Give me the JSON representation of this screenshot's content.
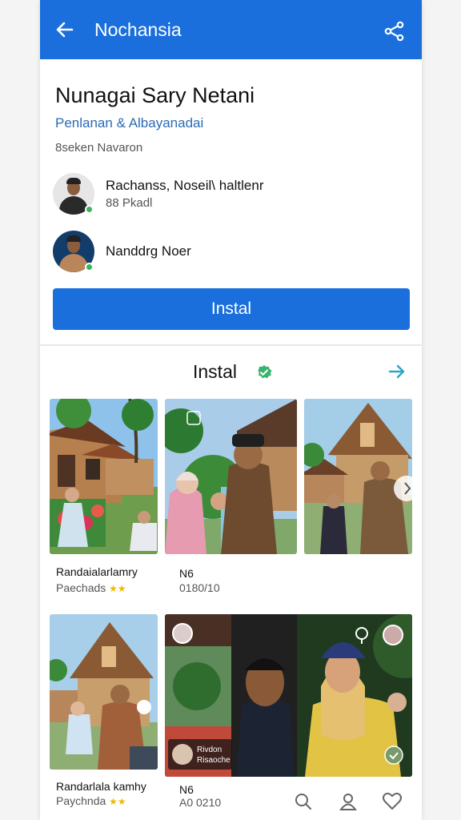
{
  "appbar": {
    "title": "Nochansia",
    "back_icon": "back-arrow-icon",
    "share_icon": "share-icon",
    "color": "#1a6fdc"
  },
  "app": {
    "title": "Nunagai Sary Netani",
    "subtitle": "Penlanan & Albayanadai",
    "meta": "8seken Navaron"
  },
  "developers": [
    {
      "name": "Rachanss, Noseil\\ haltlenr",
      "role": "88 Pkadl"
    },
    {
      "name": "Nanddrg Noer",
      "role": ""
    }
  ],
  "install_button": {
    "label": "Instal"
  },
  "section": {
    "title": "Instal",
    "verified_icon": "verified-check-icon",
    "more_icon": "arrow-right-icon"
  },
  "gallery": [
    {
      "name": "Randaialarlamry",
      "sub": "Paechads",
      "rating": "★★"
    },
    {
      "name": "N6",
      "sub": "0180/10"
    },
    {
      "name": "",
      "sub": ""
    },
    {
      "name": "Randarlala kamhy",
      "sub": "Paychnda",
      "rating": "★★"
    },
    {
      "name": "N6",
      "sub": "A0 0210"
    },
    {
      "overlay": "Rivdon\nRisaoche"
    }
  ],
  "bottom_icons": [
    "search-icon",
    "profile-icon",
    "heart-icon"
  ]
}
